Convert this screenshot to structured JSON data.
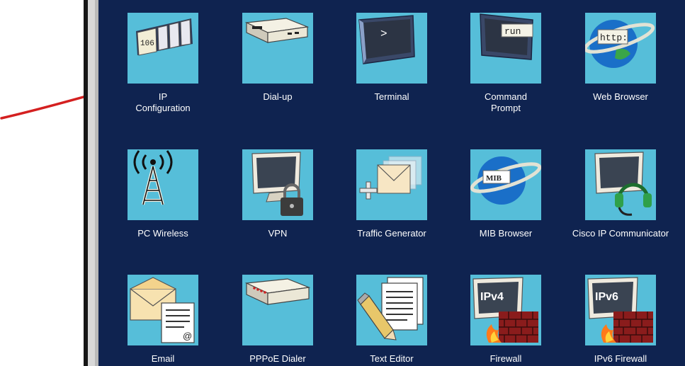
{
  "desktop": {
    "apps": [
      {
        "id": "ip-configuration",
        "label": "IP\nConfiguration",
        "icon": "ip-configuration-icon"
      },
      {
        "id": "dial-up",
        "label": "Dial-up",
        "icon": "dial-up-modem-icon"
      },
      {
        "id": "terminal",
        "label": "Terminal",
        "icon": "terminal-icon",
        "icon_text": ">"
      },
      {
        "id": "command-prompt",
        "label": "Command\nPrompt",
        "icon": "command-prompt-icon",
        "icon_text": "run"
      },
      {
        "id": "web-browser",
        "label": "Web Browser",
        "icon": "web-browser-globe-icon",
        "icon_text": "http:"
      },
      {
        "id": "pc-wireless",
        "label": "PC Wireless",
        "icon": "wireless-tower-icon"
      },
      {
        "id": "vpn",
        "label": "VPN",
        "icon": "vpn-monitor-lock-icon"
      },
      {
        "id": "traffic-generator",
        "label": "Traffic Generator",
        "icon": "traffic-generator-envelopes-icon"
      },
      {
        "id": "mib-browser",
        "label": "MIB Browser",
        "icon": "mib-browser-globe-icon",
        "icon_text": "MIB"
      },
      {
        "id": "cisco-ip-communicator",
        "label": "Cisco IP Communicator",
        "icon": "headset-monitor-icon"
      },
      {
        "id": "email",
        "label": "Email",
        "icon": "email-envelope-icon",
        "icon_text": "@"
      },
      {
        "id": "pppoe-dialer",
        "label": "PPPoE Dialer",
        "icon": "pppoe-device-icon"
      },
      {
        "id": "text-editor",
        "label": "Text Editor",
        "icon": "text-editor-pencil-icon"
      },
      {
        "id": "firewall",
        "label": "Firewall",
        "icon": "firewall-ipv4-icon",
        "icon_text": "IPv4"
      },
      {
        "id": "ipv6-firewall",
        "label": "IPv6 Firewall",
        "icon": "firewall-ipv6-icon",
        "icon_text": "IPv6"
      }
    ],
    "ip_icon_text": "106"
  },
  "colors": {
    "desktop_background": "#0f2350",
    "tile_background": "#56bed9",
    "label_text": "#ffffff",
    "annotation_arrow": "#d42020"
  }
}
